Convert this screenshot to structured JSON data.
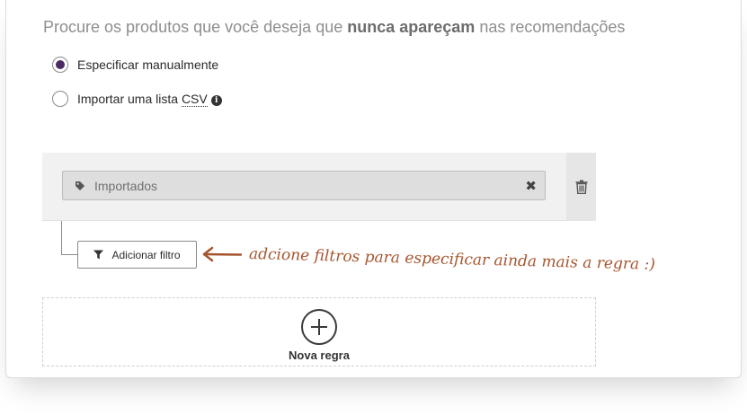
{
  "heading": {
    "prefix": "Procure os produtos que você deseja que ",
    "emphasis": "nunca apareçam",
    "suffix": " nas recomendações"
  },
  "options": {
    "manual": {
      "label": "Especificar manualmente",
      "selected": true
    },
    "csv": {
      "label_prefix": "Importar uma lista ",
      "label_link": "CSV",
      "icon": "info-icon",
      "selected": false
    }
  },
  "rule": {
    "tag_icon": "tag-icon",
    "tag_label": "Importados",
    "remove_glyph": "✖",
    "delete_icon": "trash-icon"
  },
  "filter_button": {
    "icon": "filter-icon",
    "label": "Adicionar filtro"
  },
  "annotation": {
    "arrow": "arrow-left-icon",
    "text": "adcione filtros para especificar ainda mais a regra :)"
  },
  "new_rule": {
    "icon": "plus-circle-icon",
    "label": "Nova regra"
  },
  "colors": {
    "accent": "#4b2a63",
    "annotation": "#a6552f"
  }
}
